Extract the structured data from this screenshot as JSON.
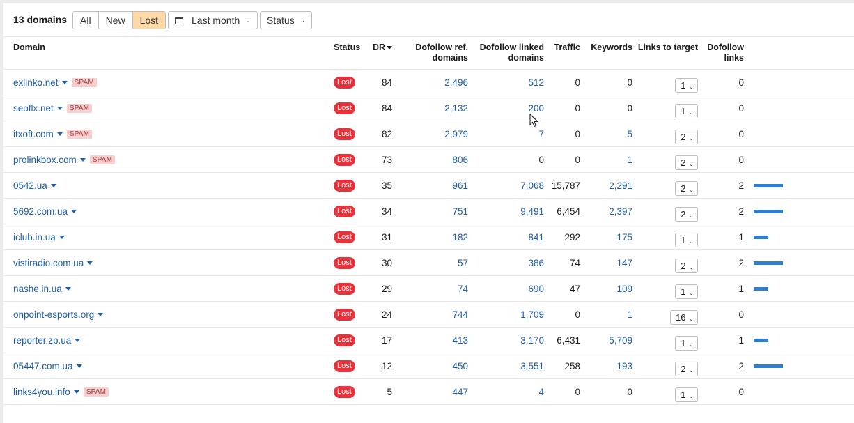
{
  "toolbar": {
    "count_label": "13 domains",
    "filters": [
      "All",
      "New",
      "Lost"
    ],
    "active_filter": "Lost",
    "date_label": "Last month",
    "status_label": "Status"
  },
  "columns": {
    "domain": "Domain",
    "status": "Status",
    "dr": "DR",
    "ref_domains": [
      "Dofollow ref.",
      "domains"
    ],
    "linked_domains": [
      "Dofollow linked",
      "domains"
    ],
    "traffic": "Traffic",
    "keywords": "Keywords",
    "links_to_target": "Links to target",
    "dofollow_links": [
      "Dofollow",
      "links"
    ]
  },
  "rows": [
    {
      "domain": "exlinko.net",
      "spam": "SPAM",
      "status": "Lost",
      "dr": "84",
      "ref": "2,496",
      "linked": "512",
      "traffic": "0",
      "keywords": "0",
      "ltt": "1",
      "dfl": "0",
      "bar": 0
    },
    {
      "domain": "seoflx.net",
      "spam": "SPAM",
      "status": "Lost",
      "dr": "84",
      "ref": "2,132",
      "linked": "200",
      "traffic": "0",
      "keywords": "0",
      "ltt": "1",
      "dfl": "0",
      "bar": 0
    },
    {
      "domain": "itxoft.com",
      "spam": "SPAM",
      "status": "Lost",
      "dr": "82",
      "ref": "2,979",
      "linked": "7",
      "traffic": "0",
      "keywords": "5",
      "ltt": "2",
      "dfl": "0",
      "bar": 0
    },
    {
      "domain": "prolinkbox.com",
      "spam": "SPAM",
      "status": "Lost",
      "dr": "73",
      "ref": "806",
      "linked": "0",
      "traffic": "0",
      "keywords": "1",
      "ltt": "2",
      "dfl": "0",
      "bar": 0
    },
    {
      "domain": "0542.ua",
      "spam": "",
      "status": "Lost",
      "dr": "35",
      "ref": "961",
      "linked": "7,068",
      "traffic": "15,787",
      "keywords": "2,291",
      "ltt": "2",
      "dfl": "2",
      "bar": 2
    },
    {
      "domain": "5692.com.ua",
      "spam": "",
      "status": "Lost",
      "dr": "34",
      "ref": "751",
      "linked": "9,491",
      "traffic": "6,454",
      "keywords": "2,397",
      "ltt": "2",
      "dfl": "2",
      "bar": 2
    },
    {
      "domain": "iclub.in.ua",
      "spam": "",
      "status": "Lost",
      "dr": "31",
      "ref": "182",
      "linked": "841",
      "traffic": "292",
      "keywords": "175",
      "ltt": "1",
      "dfl": "1",
      "bar": 1
    },
    {
      "domain": "vistiradio.com.ua",
      "spam": "",
      "status": "Lost",
      "dr": "30",
      "ref": "57",
      "linked": "386",
      "traffic": "74",
      "keywords": "147",
      "ltt": "2",
      "dfl": "2",
      "bar": 2
    },
    {
      "domain": "nashe.in.ua",
      "spam": "",
      "status": "Lost",
      "dr": "29",
      "ref": "74",
      "linked": "690",
      "traffic": "47",
      "keywords": "109",
      "ltt": "1",
      "dfl": "1",
      "bar": 1
    },
    {
      "domain": "onpoint-esports.org",
      "spam": "",
      "status": "Lost",
      "dr": "24",
      "ref": "744",
      "linked": "1,709",
      "traffic": "0",
      "keywords": "1",
      "ltt": "16",
      "dfl": "0",
      "bar": 0
    },
    {
      "domain": "reporter.zp.ua",
      "spam": "",
      "status": "Lost",
      "dr": "17",
      "ref": "413",
      "linked": "3,170",
      "traffic": "6,431",
      "keywords": "5,709",
      "ltt": "1",
      "dfl": "1",
      "bar": 1
    },
    {
      "domain": "05447.com.ua",
      "spam": "",
      "status": "Lost",
      "dr": "12",
      "ref": "450",
      "linked": "3,551",
      "traffic": "258",
      "keywords": "193",
      "ltt": "2",
      "dfl": "2",
      "bar": 2
    },
    {
      "domain": "links4you.info",
      "spam": "SPAM",
      "status": "Lost",
      "dr": "5",
      "ref": "447",
      "linked": "4",
      "traffic": "0",
      "keywords": "0",
      "ltt": "1",
      "dfl": "0",
      "bar": 0
    }
  ],
  "icons": {
    "calendar": "calendar-icon",
    "chevron": "chevron-down-icon",
    "cursor": "mouse-cursor-icon"
  },
  "colors": {
    "accent_filter": "#ffd8a6",
    "lost_badge": "#e5323b",
    "spam_badge": "#f7cfcf",
    "link": "#1f5ea8",
    "bar": "#2f7fd1"
  }
}
